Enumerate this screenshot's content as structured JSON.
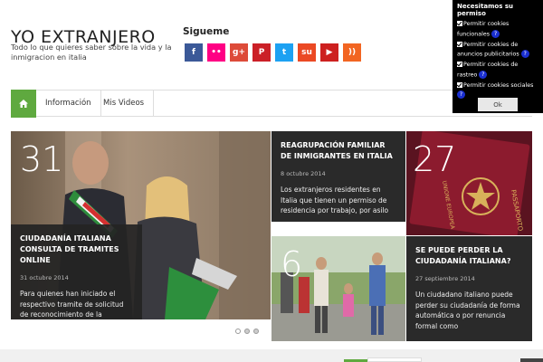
{
  "site": {
    "title": "YO EXTRANJERO",
    "description": "Todo lo que quieres saber sobre la vida y la inmigracion en italia"
  },
  "follow": {
    "title": "Sigueme",
    "icons": [
      {
        "name": "facebook-icon",
        "glyph": "f",
        "color": "#3b5998"
      },
      {
        "name": "flickr-icon",
        "glyph": "••",
        "color": "#ff0084"
      },
      {
        "name": "google-plus-icon",
        "glyph": "g+",
        "color": "#dd4b39"
      },
      {
        "name": "pinterest-icon",
        "glyph": "P",
        "color": "#cb2027"
      },
      {
        "name": "twitter-icon",
        "glyph": "t",
        "color": "#1da1f2"
      },
      {
        "name": "stumbleupon-icon",
        "glyph": "su",
        "color": "#eb4924"
      },
      {
        "name": "youtube-icon",
        "glyph": "▶",
        "color": "#cd201f"
      },
      {
        "name": "rss-icon",
        "glyph": "))",
        "color": "#f26522"
      }
    ]
  },
  "nav": {
    "home_icon": "home-icon",
    "items": [
      "Información",
      "Mis Videos"
    ]
  },
  "slides": [
    {
      "number": "31",
      "title": "CIUDADANÍA ITALIANA CONSULTA DE TRAMITES ONLINE",
      "date": "31 octubre 2014",
      "text": "Para quienes han iniciado el respectivo tramite de solicitud de reconocimiento de la ciudadanía"
    },
    {
      "number": "",
      "title": "REAGRUPACIÓN FAMILIAR DE INMIGRANTES EN ITALIA",
      "date": "8 octubre 2014",
      "text": "Los extranjeros residentes en Italia que tienen un permiso de residencia por trabajo, por asilo"
    },
    {
      "number": "27",
      "title": "",
      "date": "",
      "text": ""
    },
    {
      "number": "6",
      "title": "",
      "date": "",
      "text": ""
    },
    {
      "number": "",
      "title": "SE PUEDE PERDER LA CIUDADANÍA ITALIANA?",
      "date": "27 septiembre 2014",
      "text": "Un ciudadano italiano puede perder su ciudadanía de forma automática o por renuncia formal como"
    }
  ],
  "cookie": {
    "title": "Necesitamos su permiso",
    "options": [
      "Permitir cookies funcionales",
      "Permitir cookies de anuncios publicitarios",
      "Permitir cookies de rastreo",
      "Permitir cookies sociales"
    ],
    "help_glyph": "?",
    "ok_label": "Ok"
  },
  "colors": {
    "accent": "#5fa93f",
    "card_bg": "#232323",
    "cookie_bg": "#000000"
  }
}
